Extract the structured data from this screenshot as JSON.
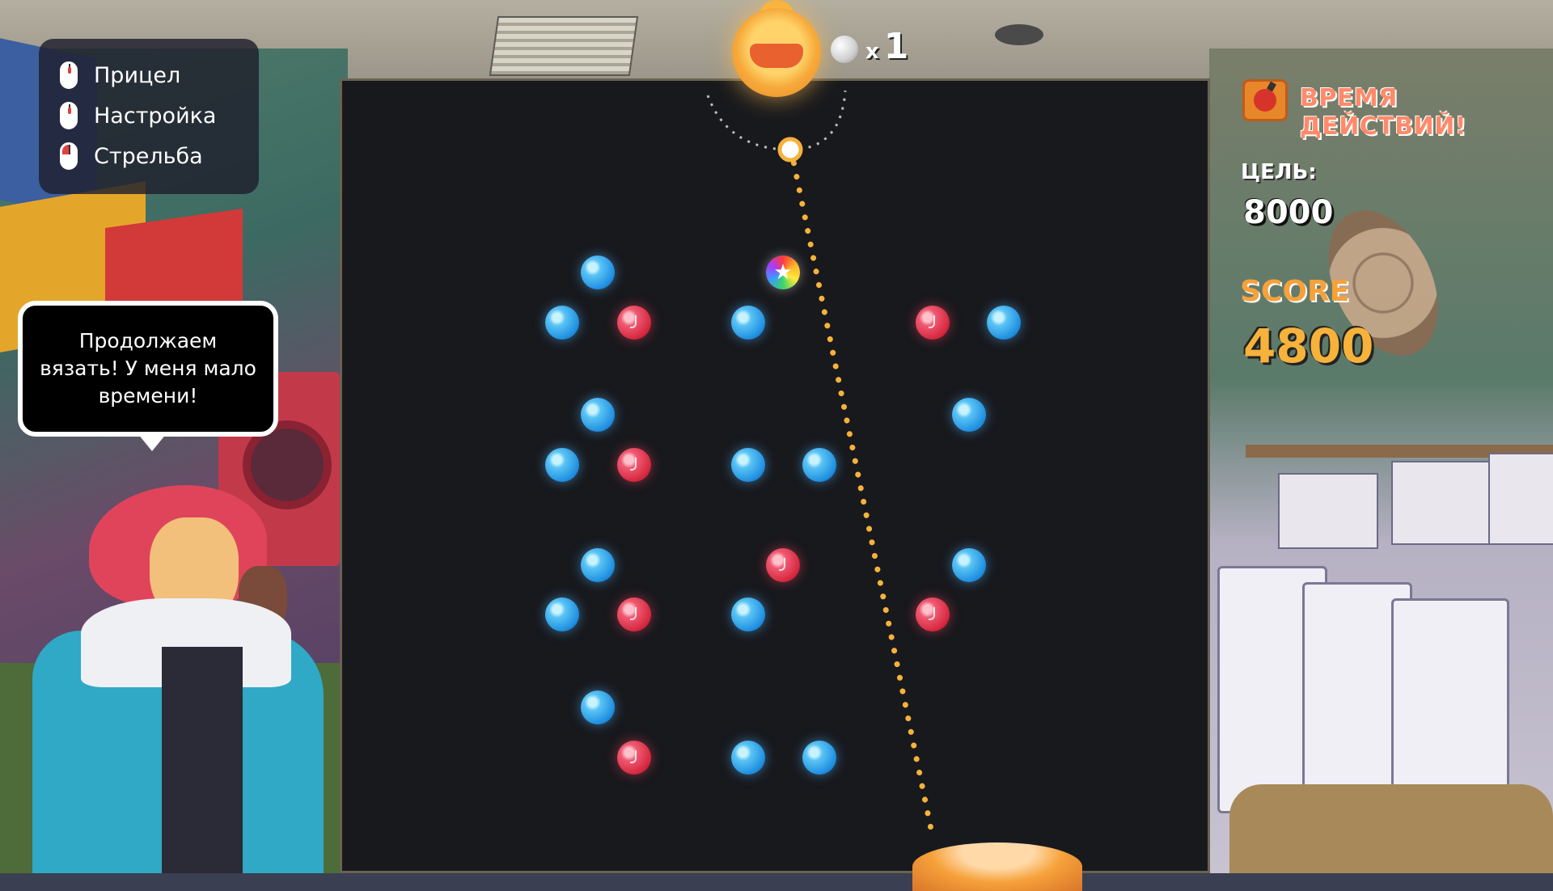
{
  "controls": {
    "items": [
      {
        "label": "Прицел",
        "icon": "mouse-aim-icon"
      },
      {
        "label": "Настройка",
        "icon": "mouse-wheel-icon"
      },
      {
        "label": "Стрельба",
        "icon": "mouse-click-icon"
      }
    ]
  },
  "speech_bubble": {
    "text": "Продолжаем вязать! У меня мало времени!"
  },
  "launcher": {
    "balls_remaining": "1",
    "multiplier_symbol": "x"
  },
  "hud": {
    "action_label": "ВРЕМЯ ДЕЙСТВИЙ!",
    "goal_label": "ЦЕЛЬ:",
    "goal_value": "8000",
    "score_label": "SCORE",
    "score_value": "4800"
  },
  "colors": {
    "blue_peg": "#1f8fe0",
    "red_peg": "#d5283f",
    "trajectory": "#f6b23a",
    "board": "#18191d"
  },
  "pegs": [
    {
      "type": "blue"
    },
    {
      "type": "blue"
    },
    {
      "type": "red"
    },
    {
      "type": "star"
    },
    {
      "type": "blue"
    },
    {
      "type": "red"
    },
    {
      "type": "blue"
    },
    {
      "type": "blue"
    },
    {
      "type": "blue"
    },
    {
      "type": "blue"
    },
    {
      "type": "red"
    },
    {
      "type": "blue"
    },
    {
      "type": "blue"
    },
    {
      "type": "blue"
    },
    {
      "type": "red"
    },
    {
      "type": "blue"
    },
    {
      "type": "blue"
    },
    {
      "type": "red"
    },
    {
      "type": "blue"
    },
    {
      "type": "red"
    },
    {
      "type": "blue"
    },
    {
      "type": "red"
    },
    {
      "type": "blue"
    },
    {
      "type": "blue"
    }
  ]
}
